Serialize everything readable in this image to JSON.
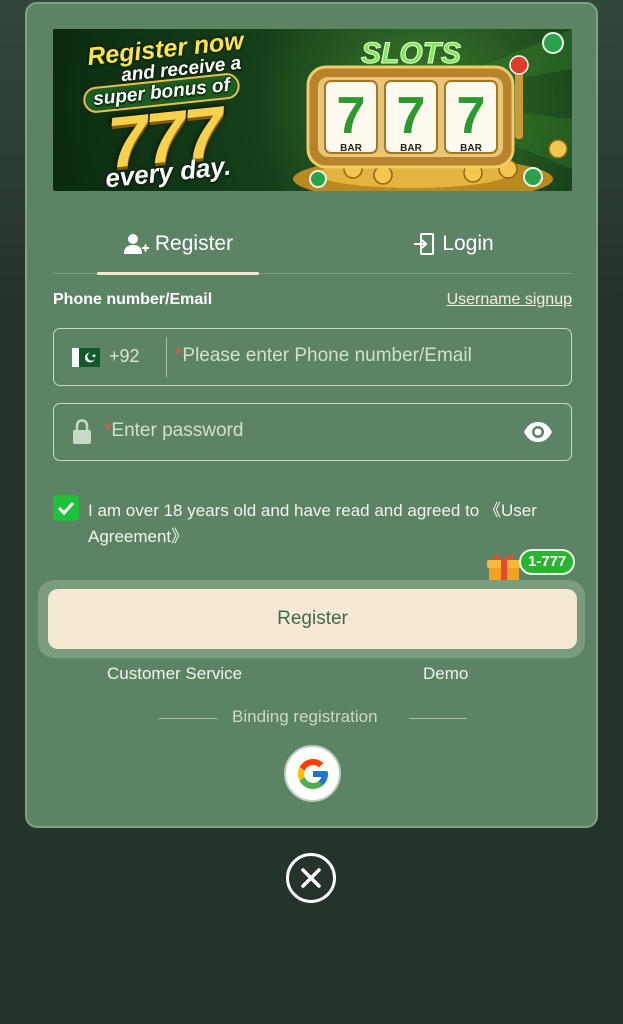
{
  "banner": {
    "line1": "Register now",
    "line2": "and receive a",
    "line3": "super bonus of",
    "big_number": "777",
    "line4": "every day.",
    "slot_label": "SLOTS",
    "reel_sevens": [
      "7",
      "7",
      "7"
    ],
    "reel_bar": "BAR"
  },
  "tabs": {
    "register": "Register",
    "login": "Login",
    "active": "register"
  },
  "form": {
    "phone_label": "Phone number/Email",
    "username_link": "Username signup",
    "country_code": "+92",
    "phone_placeholder": "Please enter Phone number/Email",
    "password_placeholder": "Enter password",
    "required_marker": "*"
  },
  "agreement": {
    "checked": true,
    "text": "I am over 18 years old and have read and agreed to 《User Agreement》"
  },
  "bonus_badge": "1-777",
  "register_button": "Register",
  "links": {
    "customer_service": "Customer Service",
    "demo": "Demo"
  },
  "binding_label": "Binding registration",
  "colors": {
    "page_bg": "#25342b",
    "modal_bg": "#5c8464",
    "button_bg": "#f5e9d3",
    "checkbox": "#1ec23a",
    "badge": "#27b52f"
  }
}
